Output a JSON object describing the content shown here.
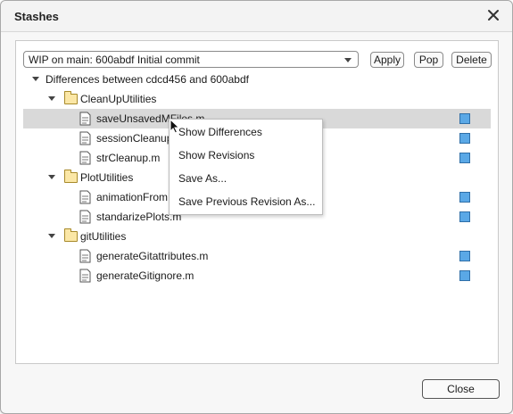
{
  "window": {
    "title": "Stashes"
  },
  "toolbar": {
    "stash_select_value": "WIP on main: 600abdf Initial commit",
    "apply_label": "Apply",
    "pop_label": "Pop",
    "delete_label": "Delete"
  },
  "tree": {
    "root_label": "Differences between cdcd456 and 600abdf",
    "folders": [
      {
        "name": "CleanUpUtilities",
        "files": [
          "saveUnsavedMFiles.m",
          "sessionCleanup",
          "strCleanup.m"
        ]
      },
      {
        "name": "PlotUtilities",
        "files": [
          "animationFrom",
          "standarizePlots.m"
        ]
      },
      {
        "name": "gitUtilities",
        "files": [
          "generateGitattributes.m",
          "generateGitignore.m"
        ]
      }
    ],
    "status_color": "#5aa8e6"
  },
  "context_menu": {
    "items": [
      "Show Differences",
      "Show Revisions",
      "Save As...",
      "Save Previous Revision As..."
    ]
  },
  "footer": {
    "close_label": "Close"
  },
  "colors": {
    "selected_row": "#d9d9d9",
    "accent": "#5aa8e6"
  }
}
